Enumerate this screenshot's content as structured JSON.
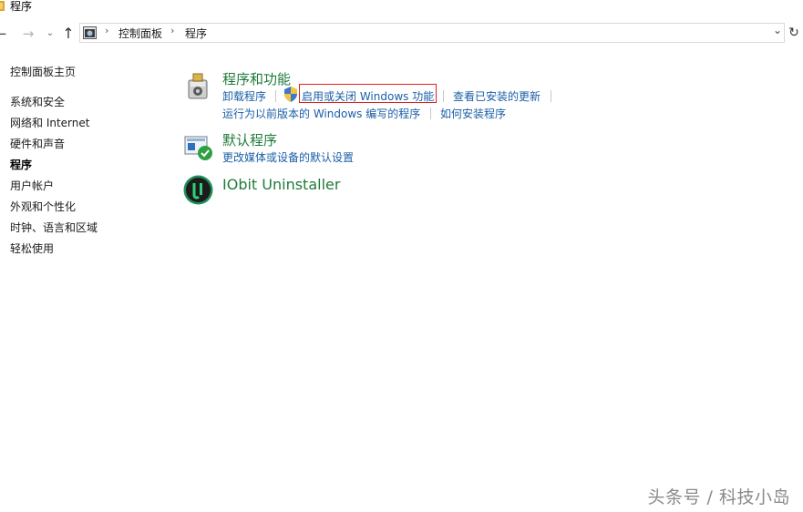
{
  "window": {
    "title": "程序"
  },
  "address": {
    "breadcrumb": [
      "控制面板",
      "程序"
    ],
    "separator": "›",
    "dropdown_glyph": "⌄",
    "refresh_glyph": "↻"
  },
  "nav": {
    "back": "←",
    "forward": "→",
    "recent": "⌄",
    "up": "↑"
  },
  "sidebar": {
    "items": [
      {
        "label": "控制面板主页"
      },
      {
        "label": "系统和安全"
      },
      {
        "label": "网络和 Internet"
      },
      {
        "label": "硬件和声音"
      },
      {
        "label": "程序",
        "active": true
      },
      {
        "label": "用户帐户"
      },
      {
        "label": "外观和个性化"
      },
      {
        "label": "时钟、语言和区域"
      },
      {
        "label": "轻松使用"
      }
    ]
  },
  "categories": [
    {
      "title": "程序和功能",
      "icon": "programs-features-icon",
      "links_row1": [
        "卸载程序",
        "启用或关闭 Windows 功能",
        "查看已安装的更新"
      ],
      "links_row2": [
        "运行为以前版本的 Windows 编写的程序",
        "如何安装程序"
      ]
    },
    {
      "title": "默认程序",
      "icon": "default-programs-icon",
      "links_row1": [
        "更改媒体或设备的默认设置"
      ]
    },
    {
      "title": "IObit Uninstaller",
      "icon": "iobit-icon"
    }
  ],
  "colors": {
    "category_title": "#1f7a3a",
    "link": "#1a5fa8",
    "highlight_box": "#e0201c"
  },
  "watermark": "头条号 / 科技小岛"
}
